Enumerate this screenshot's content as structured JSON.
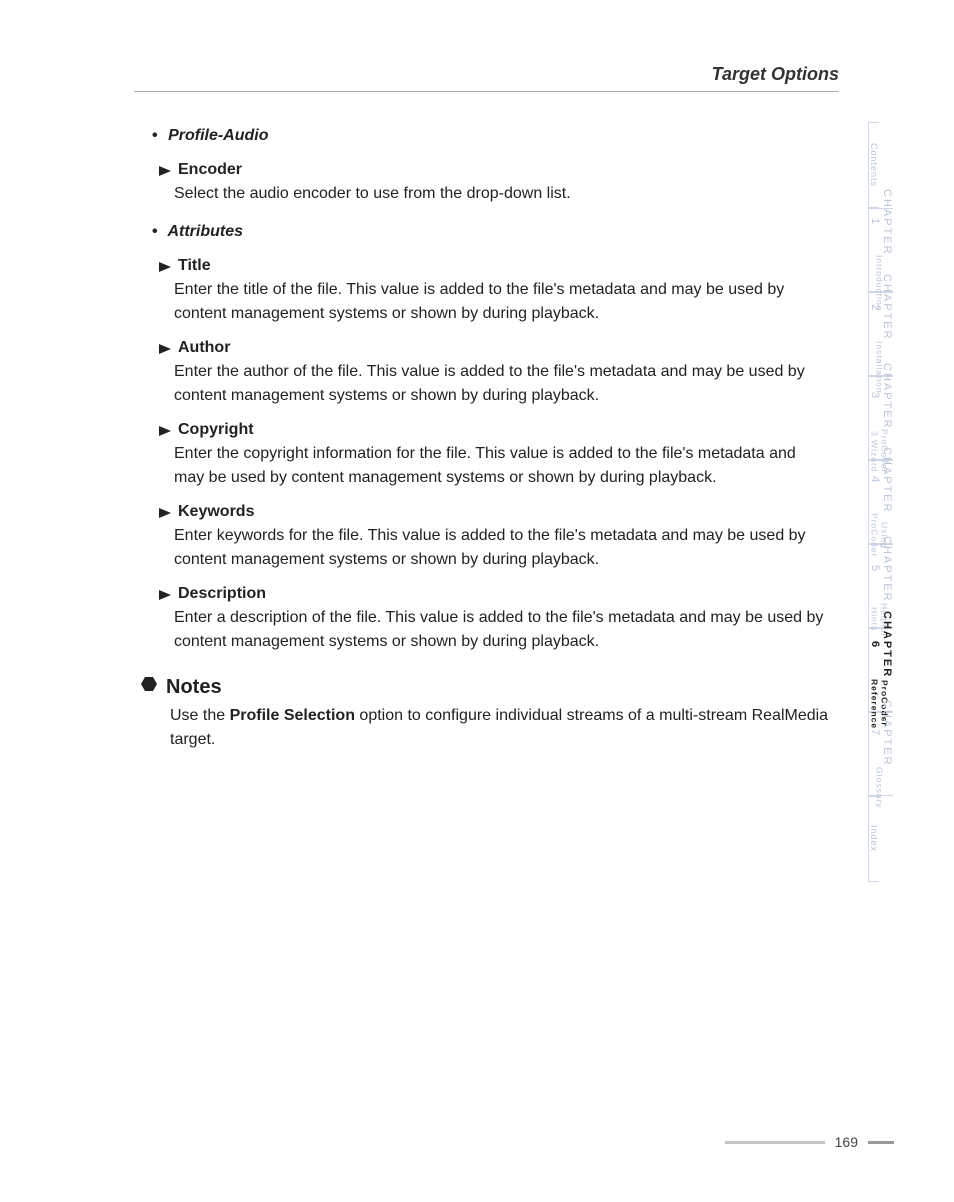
{
  "header": {
    "title": "Target Options"
  },
  "sections": [
    {
      "heading": "Profile-Audio",
      "items": [
        {
          "title": "Encoder",
          "body": "Select the audio encoder to use from the drop-down list."
        }
      ]
    },
    {
      "heading": "Attributes",
      "items": [
        {
          "title": "Title",
          "body": "Enter the title of the file. This value is added to the file's metadata and may be used by content management systems or shown by during playback."
        },
        {
          "title": "Author",
          "body": "Enter the author of the file. This value is added to the file's metadata and may be used by content management systems or shown by during playback."
        },
        {
          "title": "Copyright",
          "body": "Enter the copyright information for the file. This value is added to the file's metadata and may be used by content management systems or shown by during playback."
        },
        {
          "title": "Keywords",
          "body": "Enter keywords for the file. This value is added to the file's metadata and may be used by content management systems or shown by during playback."
        },
        {
          "title": "Description",
          "body": "Enter a description of the file. This value is added to the file's metadata and may be used by content management systems or shown by during playback."
        }
      ]
    }
  ],
  "notes": {
    "heading": "Notes",
    "prefix": "Use the ",
    "bold": "Profile Selection",
    "suffix": " option to configure individual streams of a multi-stream RealMedia target."
  },
  "sidebar": {
    "contents": "Contents",
    "tabs": [
      {
        "line1": "CHAPTER 1",
        "line2": "Introduction",
        "active": false
      },
      {
        "line1": "CHAPTER 2",
        "line2": "Installation",
        "active": false
      },
      {
        "line1": "CHAPTER 3",
        "line2": "ProCoder 3 Wizard",
        "active": false
      },
      {
        "line1": "CHAPTER 4",
        "line2": "Using ProCoder",
        "active": false
      },
      {
        "line1": "CHAPTER 5",
        "line2": "Helpful Hints",
        "active": false
      },
      {
        "line1": "CHAPTER 6",
        "line2": "ProCoder Reference",
        "active": true
      },
      {
        "line1": "CHAPTER 7",
        "line2": "Glossary",
        "active": false
      }
    ],
    "index": "Index"
  },
  "footer": {
    "page": "169"
  }
}
